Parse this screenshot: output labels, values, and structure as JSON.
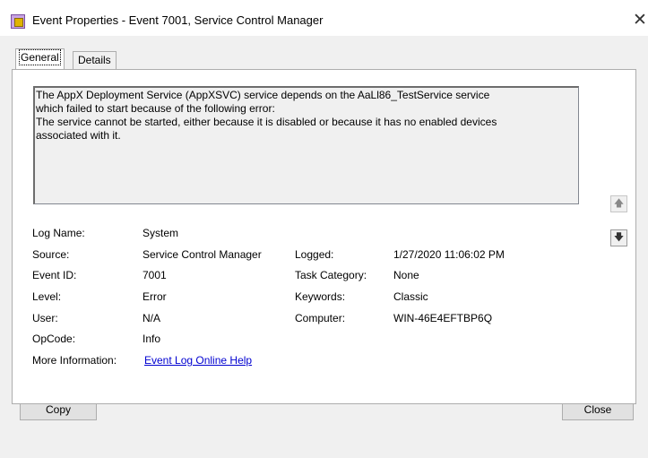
{
  "window": {
    "title": "Event Properties - Event 7001, Service Control Manager",
    "close_glyph": "✕"
  },
  "tabs": [
    {
      "label": "General",
      "active": true
    },
    {
      "label": "Details",
      "active": false
    }
  ],
  "description_lines": [
    "The AppX Deployment Service (AppXSVC) service depends on the AaLl86_TestService service",
    "which failed to start because of the following error:",
    "The service cannot be started, either because it is disabled or because it has no enabled devices",
    "associated with it."
  ],
  "fields": {
    "log_name": {
      "label": "Log Name:",
      "value": "System"
    },
    "source": {
      "label": "Source:",
      "value": "Service Control Manager"
    },
    "logged": {
      "label": "Logged:",
      "value": "1/27/2020 11:06:02 PM"
    },
    "event_id": {
      "label": "Event ID:",
      "value": "7001"
    },
    "task_category": {
      "label": "Task Category:",
      "value": "None"
    },
    "level": {
      "label": "Level:",
      "value": "Error"
    },
    "keywords": {
      "label": "Keywords:",
      "value": "Classic"
    },
    "user": {
      "label": "User:",
      "value": "N/A"
    },
    "computer": {
      "label": "Computer:",
      "value": "WIN-46E4EFTBP6Q"
    },
    "opcode": {
      "label": "OpCode:",
      "value": "Info"
    },
    "more_info": {
      "label": "More Information:",
      "value": "Event Log Online Help"
    }
  },
  "scroll": {
    "up_glyph": "🡅",
    "down_glyph": "🡇"
  },
  "buttons": {
    "copy": "Copy",
    "close": "Close"
  }
}
